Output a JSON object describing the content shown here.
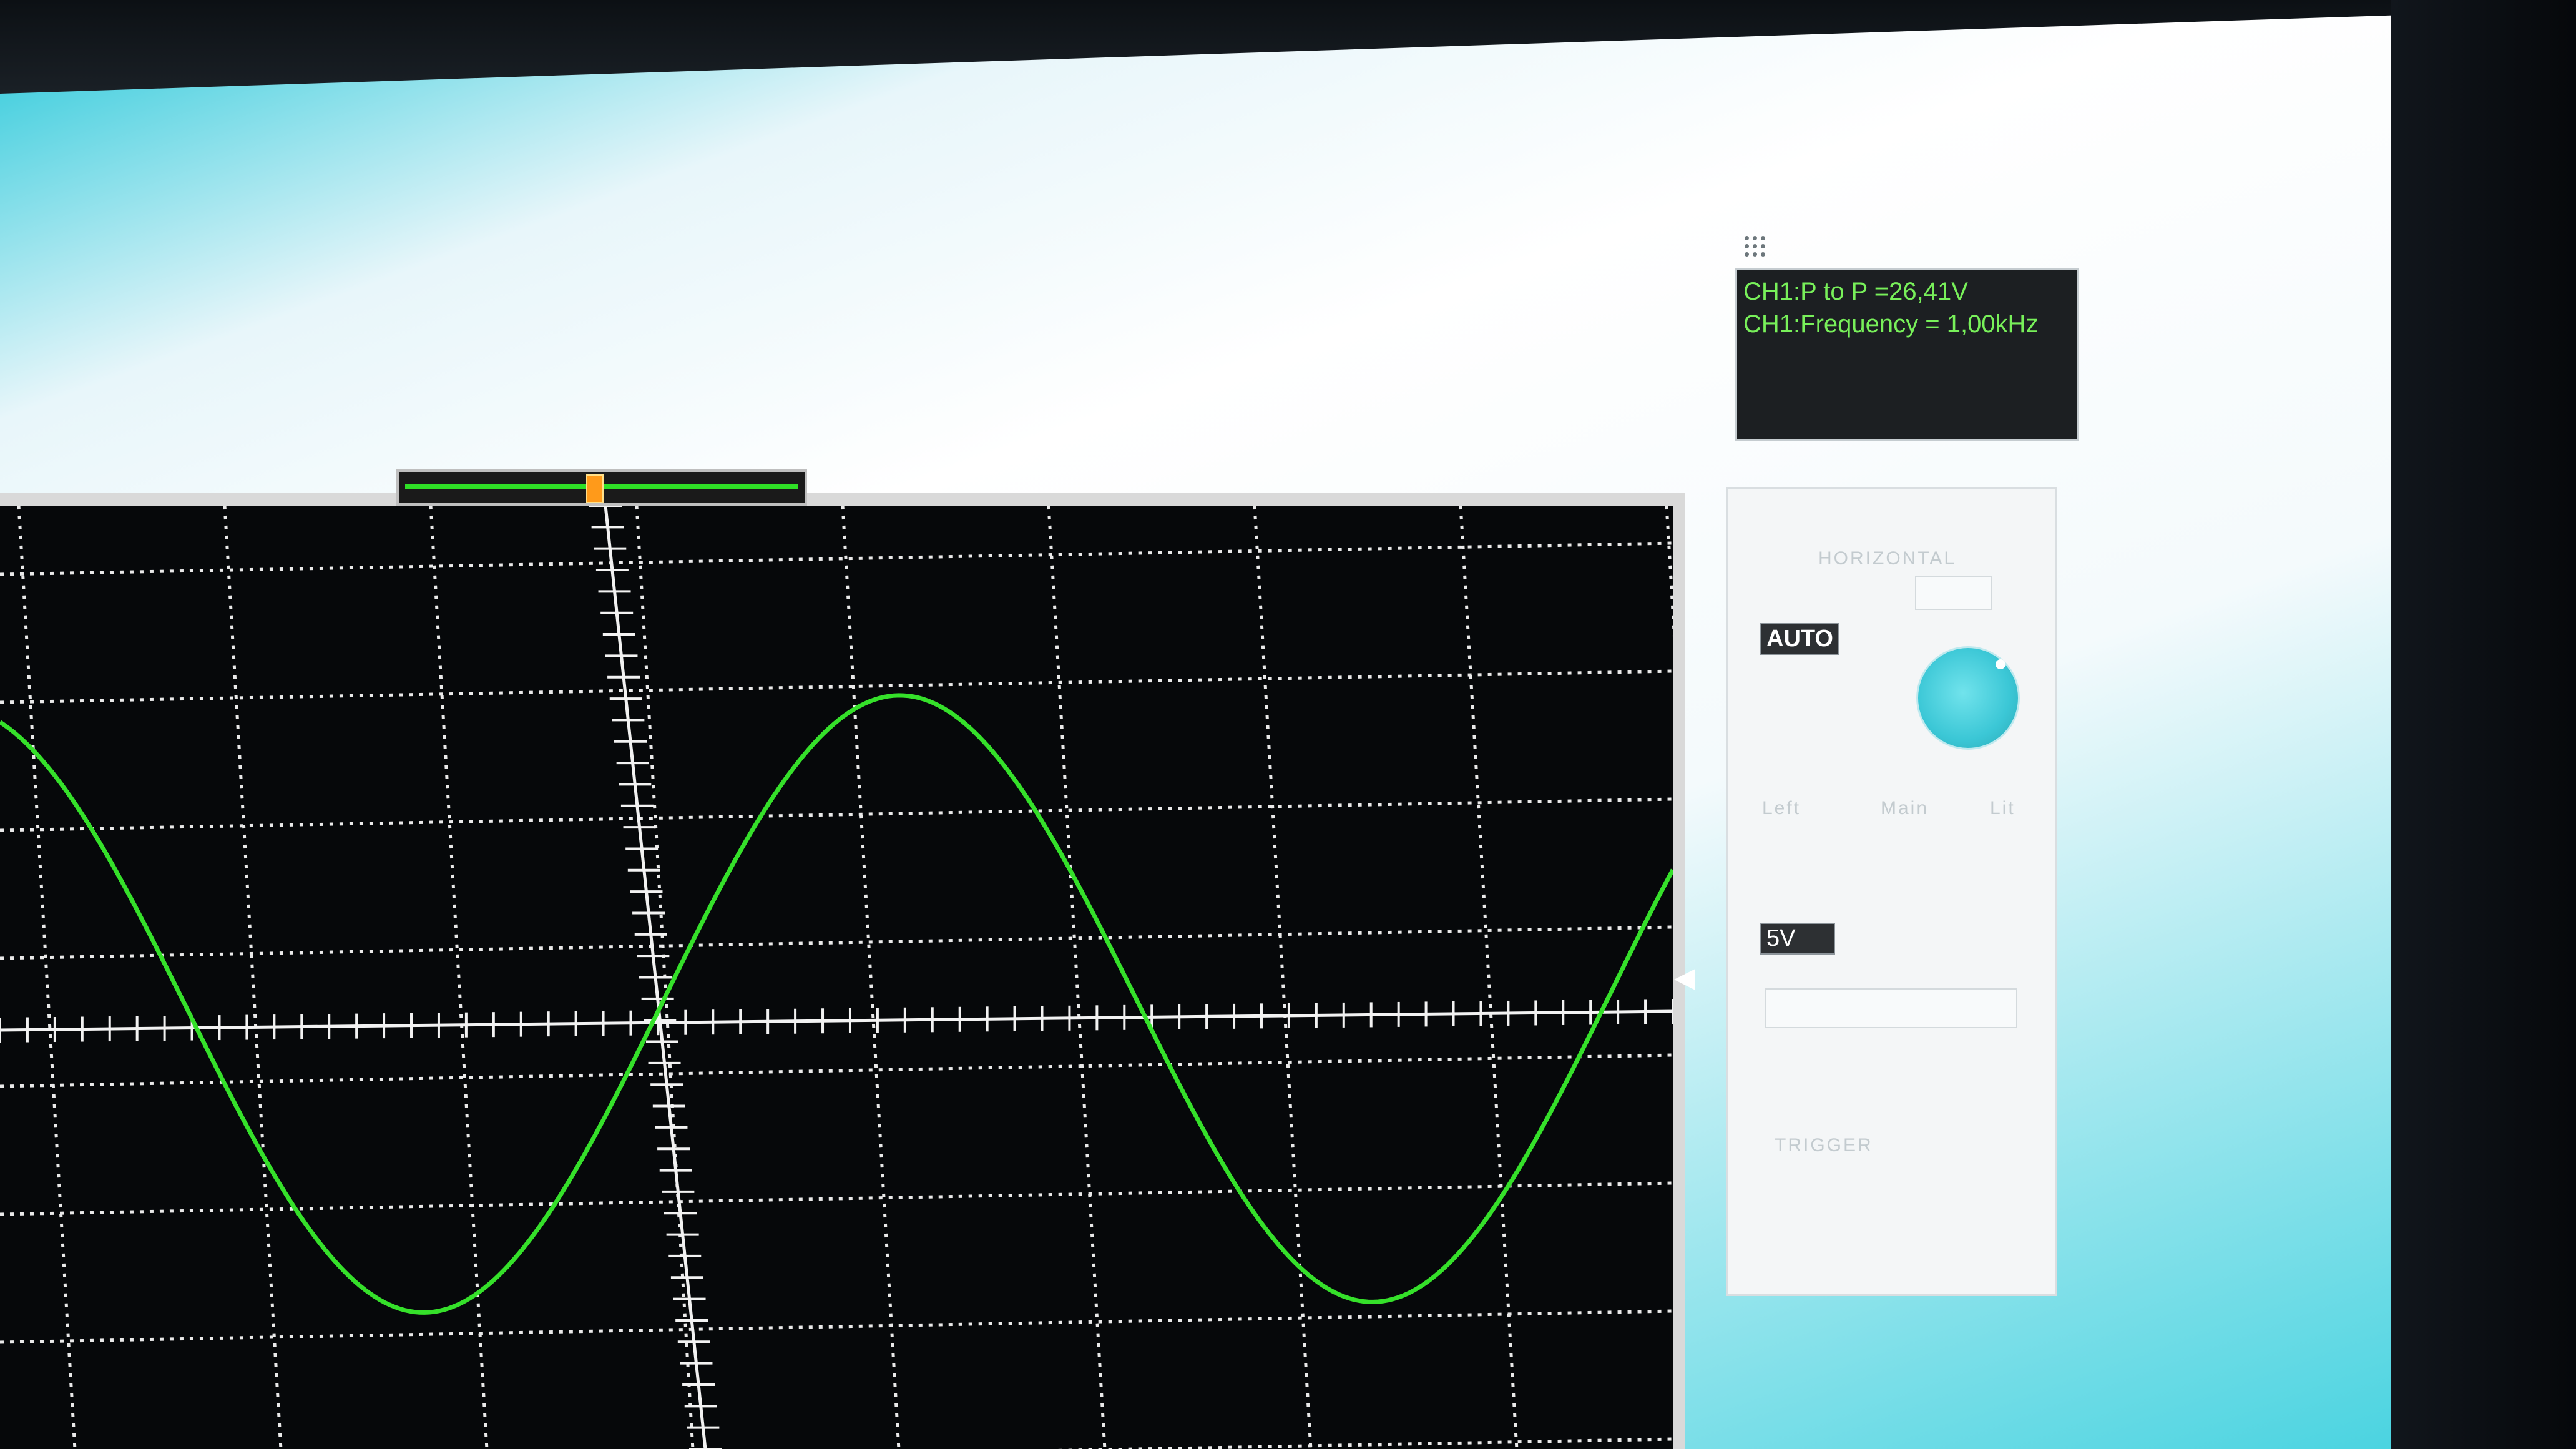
{
  "measurements": {
    "p2p": "CH1:P to P =26,41V",
    "frequency": "CH1:Frequency = 1,00kHz"
  },
  "controls": {
    "horizontal_label": "HORIZONTAL",
    "auto_button": "AUTO",
    "volts_div": "5V",
    "mode_left": "Left",
    "mode_main": "Main",
    "mode_right": "Lit",
    "trigger_label": "TRIGGER"
  },
  "chart_data": {
    "type": "line",
    "title": "",
    "xlabel": "",
    "ylabel": "",
    "grid": true,
    "divisions": {
      "x": 8,
      "y": 7
    },
    "series": [
      {
        "name": "CH1",
        "color": "#35e02a",
        "waveform": "sine",
        "peak_to_peak_v": 26.41,
        "frequency_khz": 1.0
      }
    ]
  },
  "colors": {
    "screen_bg": "#06080a",
    "grid": "#e9e9e9",
    "trace": "#35e02a",
    "measure_text": "#78f05a"
  },
  "icons": {
    "measure_grip": "grip-icon",
    "control_grip": "grip-icon",
    "trigger_marker": "triangle-left-icon"
  }
}
